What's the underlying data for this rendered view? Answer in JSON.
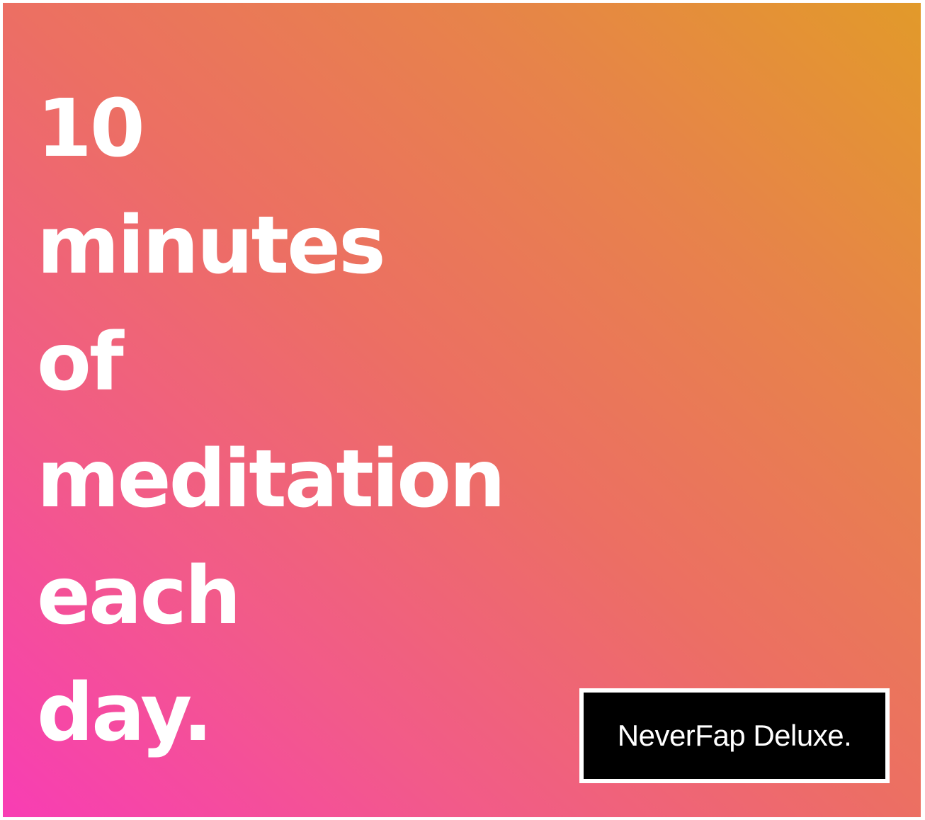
{
  "headline": {
    "lines": [
      "10",
      "minutes",
      "of",
      "meditation",
      "each",
      "day."
    ]
  },
  "badge": {
    "label": "NeverFap Deluxe."
  },
  "colors": {
    "gradient_start": "#f83db4",
    "gradient_end": "#e29a2a",
    "text": "#ffffff",
    "badge_bg": "#000000",
    "badge_border": "#ffffff"
  }
}
